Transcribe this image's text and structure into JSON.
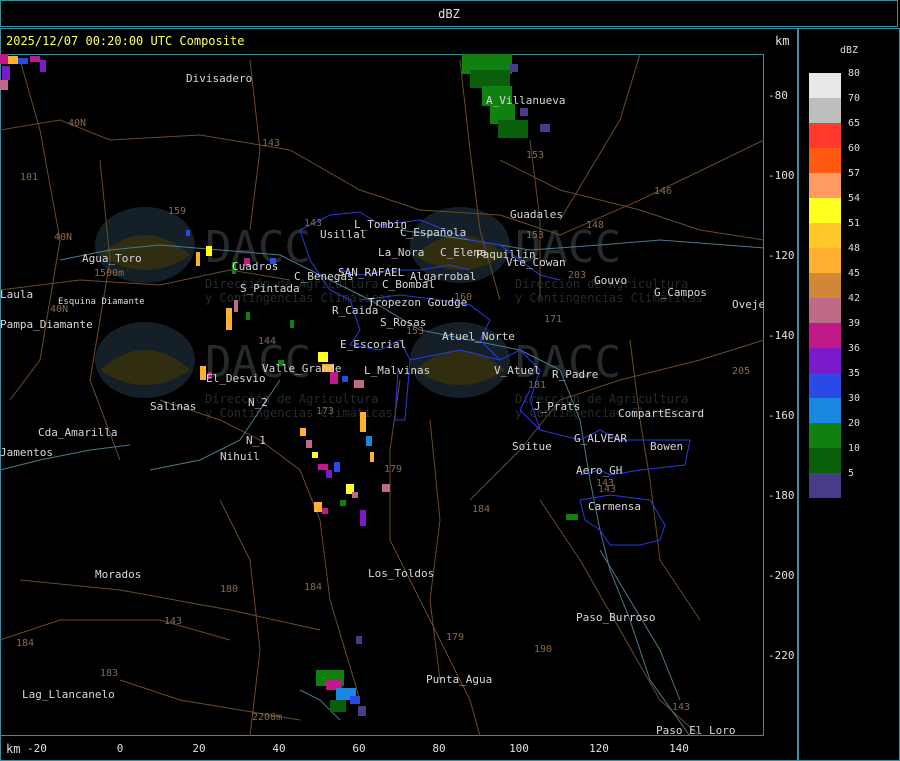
{
  "header": {
    "title": "dBZ"
  },
  "map": {
    "timestamp": "2025/12/07 00:20:00 UTC Composite",
    "km_label": "km",
    "y_ticks": [
      "-80",
      "-100",
      "-120",
      "-140",
      "-160",
      "-180",
      "-200",
      "-220"
    ],
    "x_ticks": [
      "-20",
      "0",
      "20",
      "40",
      "60",
      "80",
      "100",
      "120",
      "140"
    ],
    "places": [
      "Divisadero",
      "A_Villanueva",
      "Guadales",
      "Usillal",
      "L_Tombin",
      "C_Española",
      "La_Nora",
      "C_Elena",
      "Paquillin",
      "Vte_Cowan",
      "Gouvo",
      "G_Campos",
      "Ovejero",
      "Agua_Toro",
      "S_Pintada",
      "Cuadros",
      "SAN_RAFAEL",
      "C_Benegas",
      "C_Bombal",
      "Algarrobal",
      "R_Caida",
      "S_Rosas",
      "Tropezon Goudge",
      "Atuel_Norte",
      "E_Escorial",
      "Valle_Grande",
      "L_Malvinas",
      "V_Atuel",
      "R_Padre",
      "El_Desvio",
      "Salinas",
      "J_Prats",
      "CompartEscard",
      "N_2",
      "N_1",
      "G_ALVEAR",
      "Bowen",
      "Nihuil",
      "Soitue",
      "Cda_Amarilla",
      "Aero_GH",
      "Carmensa",
      "Los_Toldos",
      "Morados",
      "Paso_Burroso",
      "Punta_Agua",
      "Lag_Llancanelo",
      "Paso_El_Loro",
      "Pampa_Diamante",
      "Esquina Diamante",
      "Jamentos",
      "Laula"
    ],
    "road_labels": [
      "101",
      "40N",
      "40N",
      "40N",
      "143",
      "143",
      "143",
      "153",
      "159",
      "146",
      "148",
      "153",
      "203",
      "171",
      "153",
      "160",
      "144",
      "181",
      "179",
      "184",
      "173",
      "183",
      "184",
      "180",
      "179",
      "190",
      "143",
      "143",
      "205",
      "143",
      "184",
      "1500m",
      "2200m"
    ],
    "watermark": {
      "logo": "DACC",
      "line1": "Dirección de Agricultura",
      "line2": "y Contingencias Climáticas"
    }
  },
  "legend": {
    "title": "dBZ",
    "levels": [
      {
        "value": "80",
        "color": "#e8e8e8"
      },
      {
        "value": "70",
        "color": "#bdbdbd"
      },
      {
        "value": "65",
        "color": "#ff3a2a"
      },
      {
        "value": "60",
        "color": "#ff5a10"
      },
      {
        "value": "57",
        "color": "#ff9a60"
      },
      {
        "value": "54",
        "color": "#ffff20"
      },
      {
        "value": "51",
        "color": "#ffc82a"
      },
      {
        "value": "48",
        "color": "#ffb030"
      },
      {
        "value": "45",
        "color": "#d08838"
      },
      {
        "value": "42",
        "color": "#c06a8a"
      },
      {
        "value": "39",
        "color": "#c01a8a"
      },
      {
        "value": "36",
        "color": "#7a1ac8"
      },
      {
        "value": "35",
        "color": "#2a4ae8"
      },
      {
        "value": "30",
        "color": "#1a88e0"
      },
      {
        "value": "20",
        "color": "#108010"
      },
      {
        "value": "10",
        "color": "#0a600a"
      },
      {
        "value": "5",
        "color": "#4a3a8a"
      }
    ]
  }
}
